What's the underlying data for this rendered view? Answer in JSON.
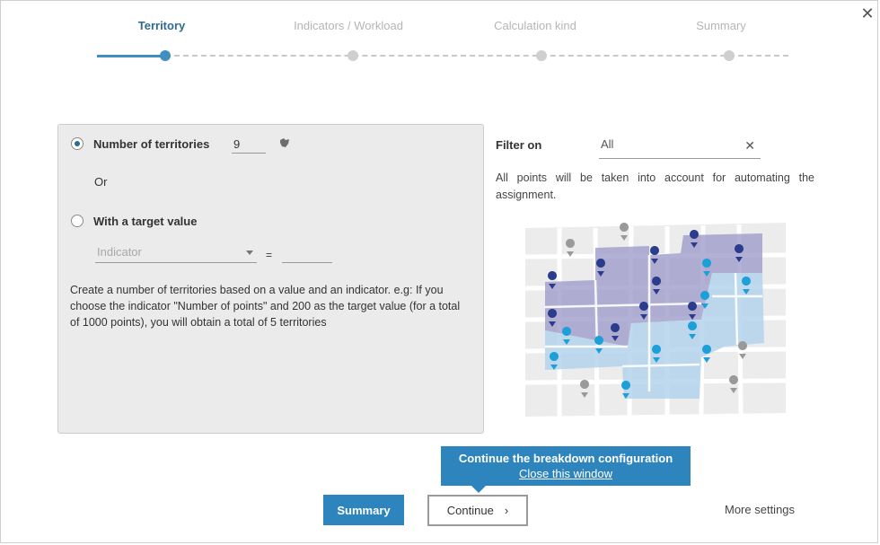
{
  "stepper": {
    "steps": [
      {
        "label": "Territory",
        "active": true
      },
      {
        "label": "Indicators / Workload",
        "active": false
      },
      {
        "label": "Calculation kind",
        "active": false
      },
      {
        "label": "Summary",
        "active": false
      }
    ]
  },
  "close_icon": "close-icon",
  "options": {
    "number_label": "Number of territories",
    "number_value": "9",
    "or_label": "Or",
    "target_label": "With a target value",
    "indicator_placeholder": "Indicator",
    "equals": "=",
    "target_value": "",
    "description": "Create a number of territories based on a value and an indicator. e.g: If you choose the indicator \"Number of points\" and 200 as the target value (for a total of 1000 points), you will obtain a total of 5 territories"
  },
  "filter": {
    "label": "Filter on",
    "value": "All",
    "info": "All points will be taken into account for automating the assignment."
  },
  "tooltip": {
    "title": "Continue the breakdown configuration",
    "link": "Close this window"
  },
  "buttons": {
    "summary": "Summary",
    "continue": "Continue",
    "more_settings": "More settings"
  },
  "colors": {
    "accent": "#2e85bd",
    "active_step": "#2e6a92",
    "zone_purple": "#9f9ccb",
    "zone_blue": "#b4d3ec",
    "pin_navy": "#2c3c8c",
    "pin_cyan": "#1e9fd8",
    "pin_grey": "#9a9a9a"
  }
}
